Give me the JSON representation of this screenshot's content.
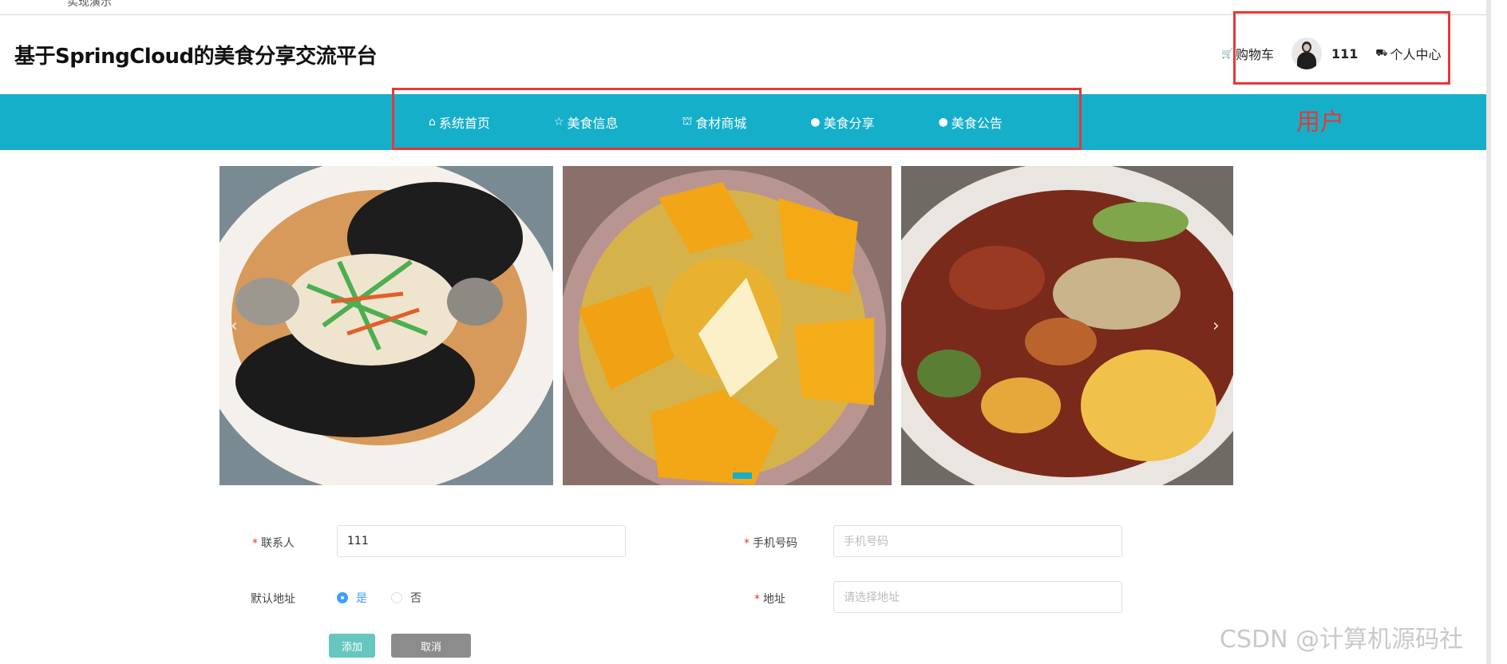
{
  "top_strip": {
    "clipped_text": "实现演示"
  },
  "header": {
    "title": "基于SpringCloud的美食分享交流平台",
    "cart_label": "购物车",
    "username": "111",
    "profile_label": "个人中心"
  },
  "nav": {
    "items": [
      {
        "label": "系统首页",
        "icon": "home-icon"
      },
      {
        "label": "美食信息",
        "icon": "star-icon"
      },
      {
        "label": "食材商城",
        "icon": "bag-icon"
      },
      {
        "label": "美食分享",
        "icon": "info-icon"
      },
      {
        "label": "美食公告",
        "icon": "question-icon"
      }
    ]
  },
  "annotation": {
    "label": "用户",
    "color": "#e53935"
  },
  "carousel": {
    "prev_arrow": "‹",
    "next_arrow": "›",
    "slide_count": 3,
    "active_dot": 1
  },
  "form": {
    "contact_label": "联系人",
    "contact_value": "111",
    "phone_label": "手机号码",
    "phone_placeholder": "手机号码",
    "default_address_label": "默认地址",
    "radio_yes": "是",
    "radio_no": "否",
    "address_label": "地址",
    "address_placeholder": "请选择地址",
    "add_button": "添加",
    "cancel_button": "取消"
  },
  "watermark": "CSDN @计算机源码社",
  "colors": {
    "nav_bg": "#16afca",
    "accent": "#409eff",
    "required": "#e53935"
  }
}
